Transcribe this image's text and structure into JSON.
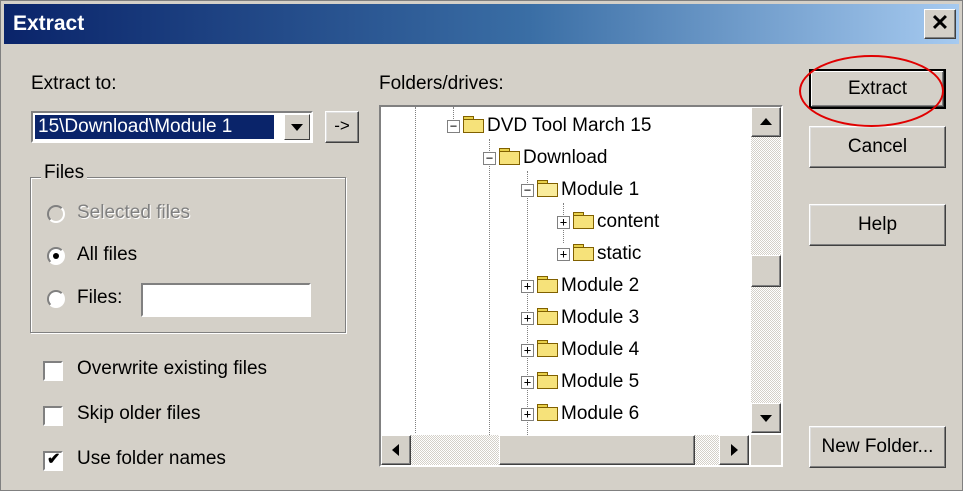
{
  "window": {
    "title": "Extract"
  },
  "extract_to": {
    "label": "Extract to:",
    "value": "15\\Download\\Module 1",
    "browse_label": "->"
  },
  "folders": {
    "label": "Folders/drives:",
    "tree": [
      {
        "label": "DVD Tool March 15",
        "level": 0,
        "expander": "minus"
      },
      {
        "label": "Download",
        "level": 1,
        "expander": "minus"
      },
      {
        "label": "Module 1",
        "level": 2,
        "expander": "minus",
        "open": true
      },
      {
        "label": "content",
        "level": 3,
        "expander": "plus"
      },
      {
        "label": "static",
        "level": 3,
        "expander": "plus"
      },
      {
        "label": "Module 2",
        "level": 2,
        "expander": "plus"
      },
      {
        "label": "Module 3",
        "level": 2,
        "expander": "plus"
      },
      {
        "label": "Module 4",
        "level": 2,
        "expander": "plus"
      },
      {
        "label": "Module 5",
        "level": 2,
        "expander": "plus"
      },
      {
        "label": "Module 6",
        "level": 2,
        "expander": "plus"
      }
    ]
  },
  "files_group": {
    "title": "Files",
    "selected_files": "Selected files",
    "all_files": "All files",
    "files": "Files:",
    "files_value": "",
    "selected_option": "all_files"
  },
  "options": {
    "overwrite": {
      "label": "Overwrite existing files",
      "checked": false
    },
    "skip_older": {
      "label": "Skip older files",
      "checked": false
    },
    "use_folder_names": {
      "label": "Use folder names",
      "checked": true
    }
  },
  "buttons": {
    "extract": "Extract",
    "cancel": "Cancel",
    "help": "Help",
    "new_folder": "New Folder..."
  },
  "colors": {
    "title_bar_start": "#0a246a",
    "title_bar_end": "#a6caf0",
    "dialog_face": "#d4d0c8",
    "selection": "#0a246a",
    "annotation_ring": "#e00000"
  }
}
